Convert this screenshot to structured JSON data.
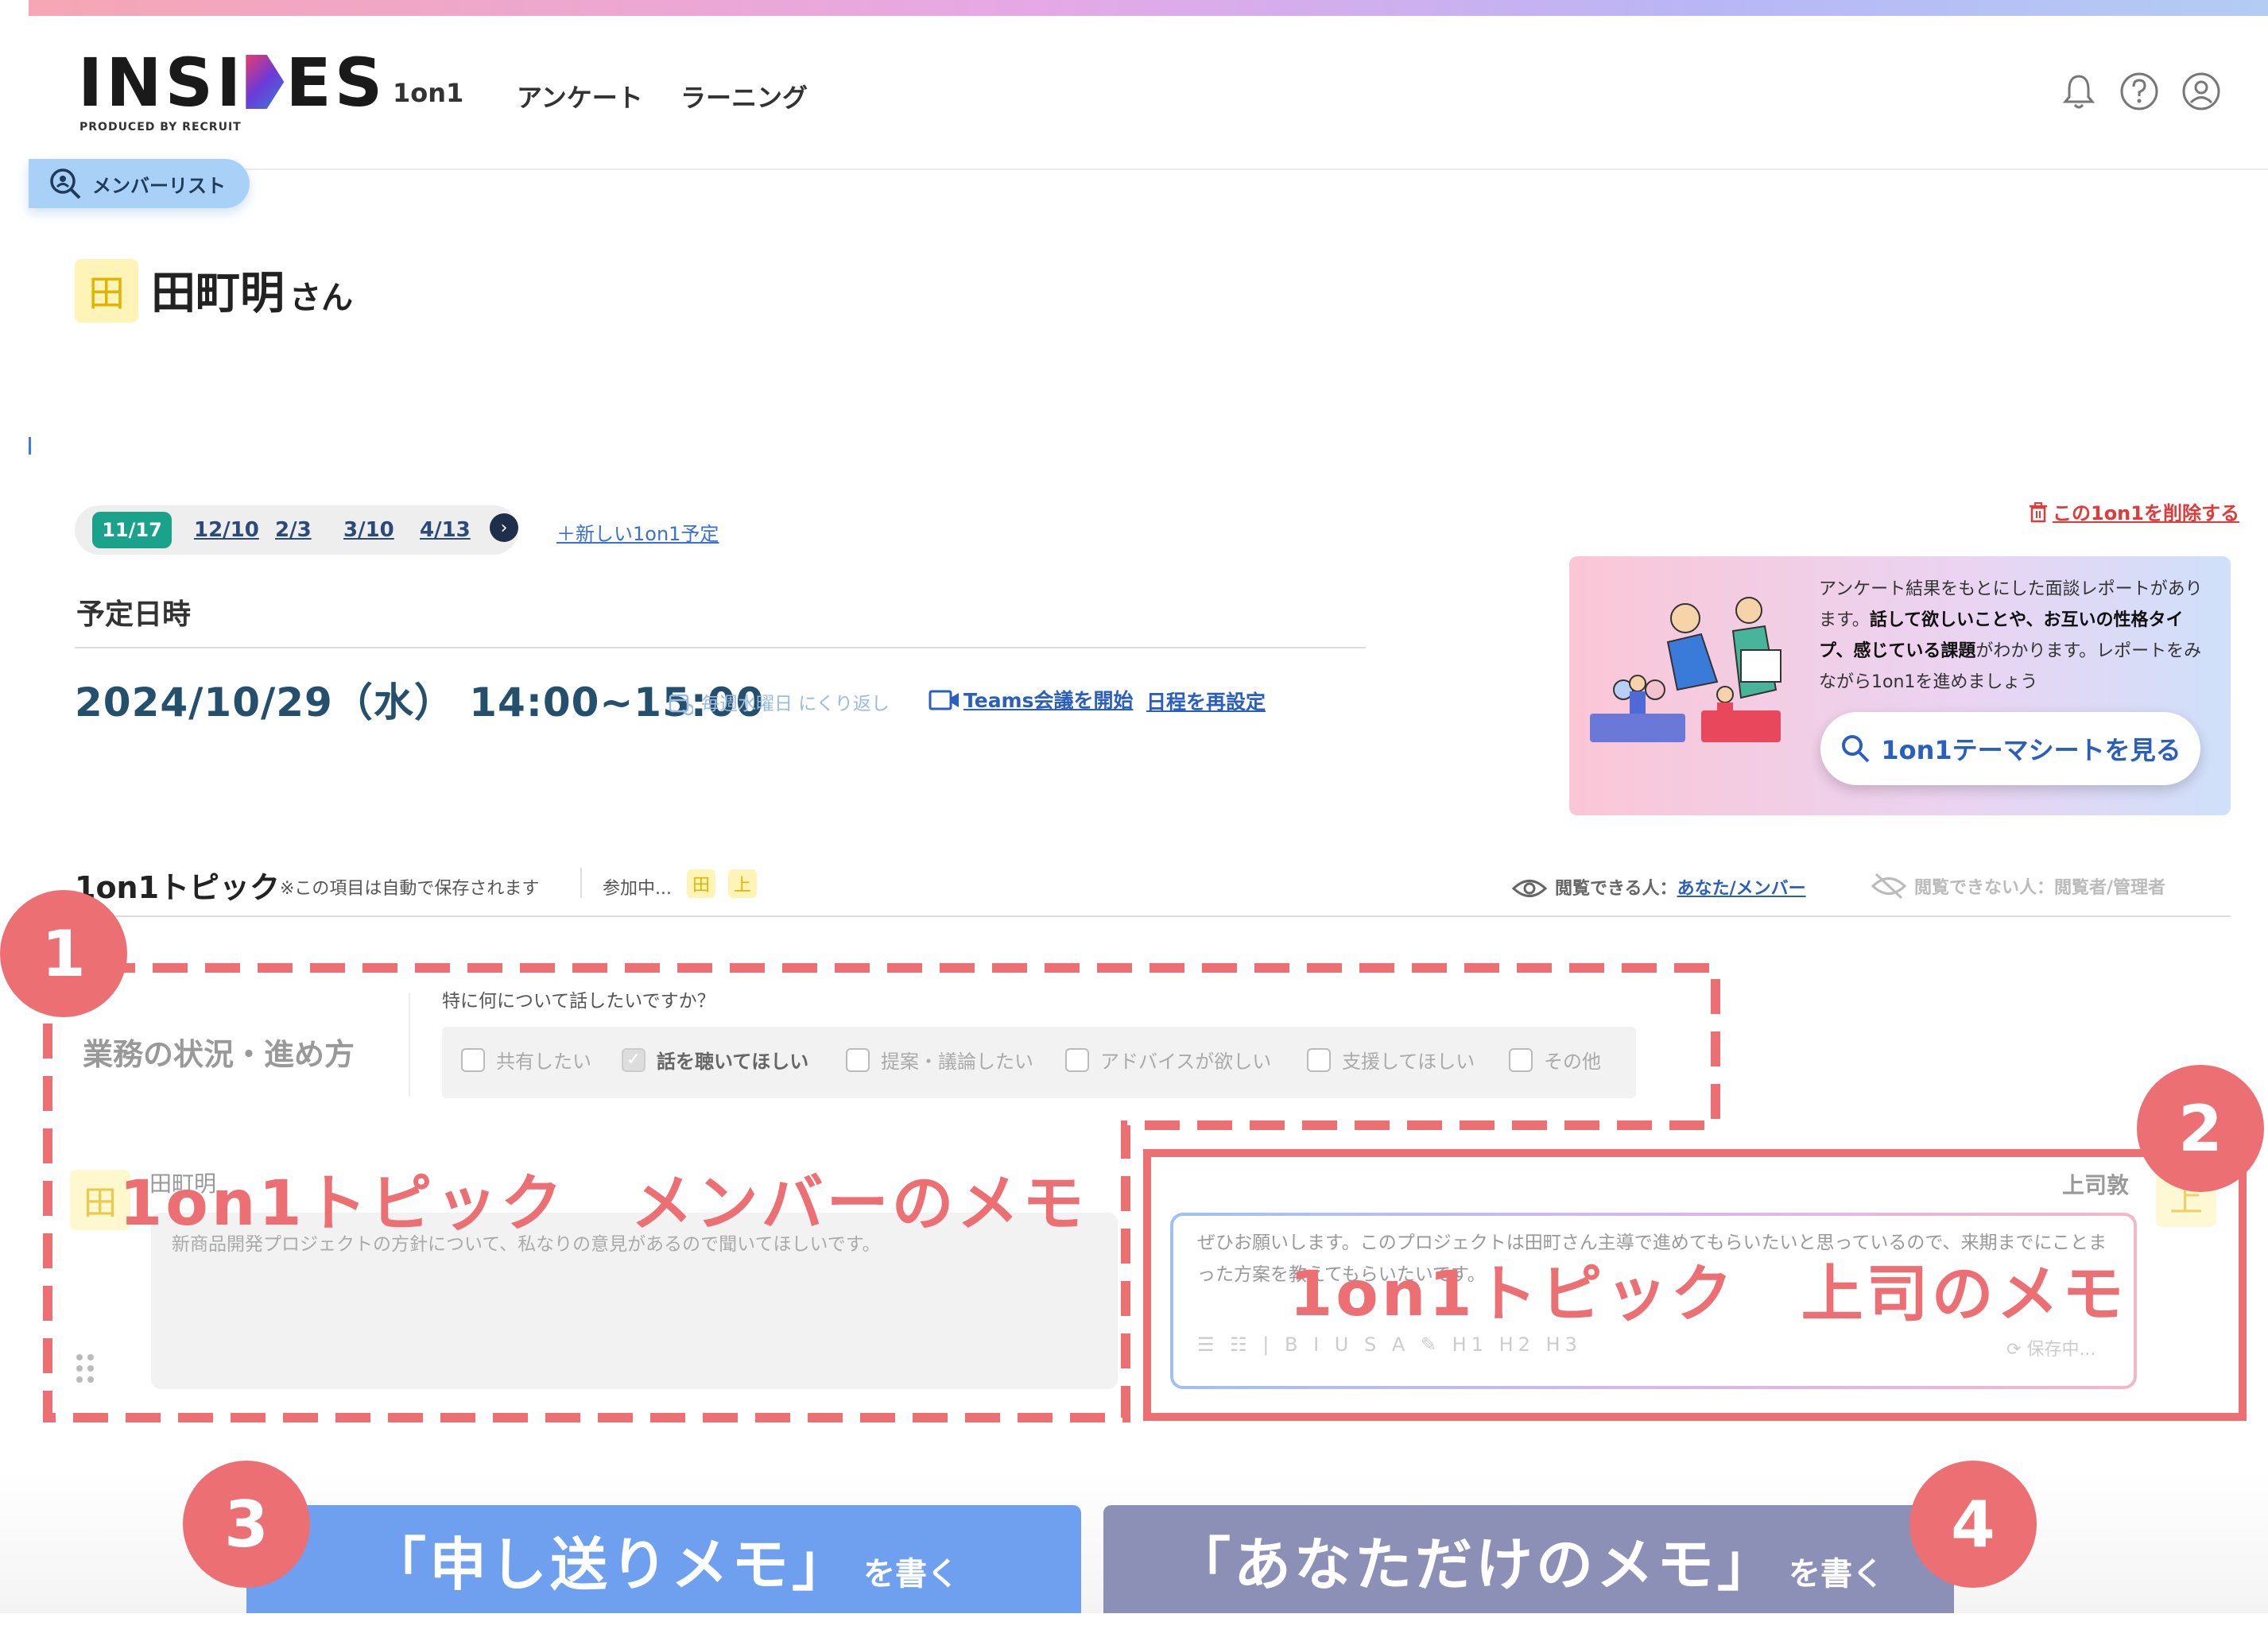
{
  "header": {
    "logo_text_left": "INSI",
    "logo_text_right": "ES",
    "logo_sub": "PRODUCED BY RECRUIT",
    "nav": [
      "1on1",
      "アンケート",
      "ラーニング"
    ],
    "icons": [
      "bell-icon",
      "help-icon",
      "user-icon"
    ]
  },
  "member_list_tab": "メンバーリスト",
  "person": {
    "avatar": "田",
    "name": "田町明",
    "honorific": "さん"
  },
  "dates": {
    "selected": "11/17",
    "others": [
      "12/10",
      "2/3",
      "3/10",
      "4/13"
    ],
    "new_plan": "＋新しい1on1予定",
    "delete": "この1on1を削除する"
  },
  "schedule": {
    "label": "予定日時",
    "datetime": "2024/10/29（水） 14:00~15:00",
    "repeat": "毎週水曜日 にくり返し",
    "teams": "Teams会議を開始",
    "reschedule": "日程を再設定"
  },
  "promo": {
    "text_1": "アンケート結果をもとにした面談レポートがあります。",
    "text_b1": "話して欲しいことや、お互いの性格タイプ、感じている課題",
    "text_2": "がわかります。レポートをみながら1on1を進めましょう",
    "button": "1on1テーマシートを見る"
  },
  "topic": {
    "title": "1on1トピック",
    "note": "※この項目は自動で保存されます",
    "participants_label": "参加中...",
    "participants": [
      "田",
      "上"
    ],
    "viewable_label": "閲覧できる人：",
    "viewable_value": "あなた/メンバー",
    "not_viewable": "閲覧できない人：閲覧者/管理者"
  },
  "item": {
    "title": "業務の状況・進め方",
    "question": "特に何について話したいですか？",
    "options": [
      {
        "label": "共有したい",
        "checked": false
      },
      {
        "label": "話を聴いてほしい",
        "checked": true
      },
      {
        "label": "提案・議論したい",
        "checked": false
      },
      {
        "label": "アドバイスが欲しい",
        "checked": false
      },
      {
        "label": "支援してほしい",
        "checked": false
      },
      {
        "label": "その他",
        "checked": false
      }
    ]
  },
  "member_memo": {
    "avatar": "田",
    "name": "田町明",
    "text": "新商品開発プロジェクトの方針について、私なりの意見があるので聞いてほしいです。"
  },
  "boss_memo": {
    "avatar": "上",
    "name": "上司敦",
    "text": "ぜひお願いします。このプロジェクトは田町さん主導で進めてもらいたいと思っているので、来期までにことまった方案を教えてもらいたいです。",
    "toolbar": "☰ ☷ | B I U S A ✎ H1 H2 H3",
    "saving": "保存中..."
  },
  "overlays": {
    "badges": [
      "1",
      "2",
      "3",
      "4"
    ],
    "label_member": "1on1トピック　メンバーのメモ",
    "label_boss": "1on1トピック　上司のメモ",
    "accent": "#ec6f73"
  },
  "bottom_buttons": {
    "handover_main": "「申し送りメモ」",
    "handover_sub": "を書く",
    "private_main": "「あなただけのメモ」",
    "private_sub": "を書く"
  }
}
